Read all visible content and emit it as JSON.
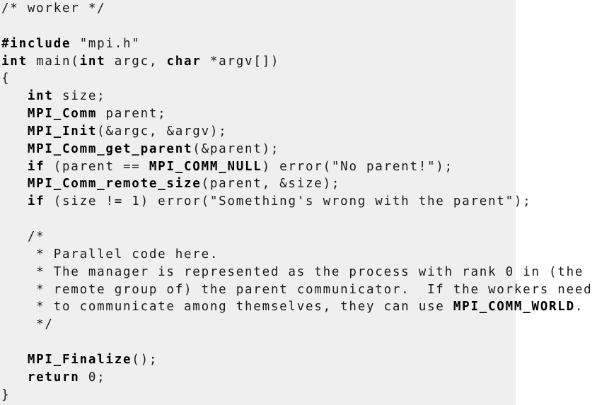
{
  "code_lines": [
    [
      {
        "t": "/* worker */",
        "s": "plain"
      }
    ],
    [],
    [
      {
        "t": "#include",
        "s": "kw"
      },
      {
        "t": " \"mpi.h\"",
        "s": "plain"
      }
    ],
    [
      {
        "t": "int",
        "s": "kw"
      },
      {
        "t": " main(",
        "s": "plain"
      },
      {
        "t": "int",
        "s": "kw"
      },
      {
        "t": " argc, ",
        "s": "plain"
      },
      {
        "t": "char",
        "s": "kw"
      },
      {
        "t": " *argv[])",
        "s": "plain"
      }
    ],
    [
      {
        "t": "{",
        "s": "plain"
      }
    ],
    [
      {
        "t": "   ",
        "s": "plain"
      },
      {
        "t": "int",
        "s": "kw"
      },
      {
        "t": " size;",
        "s": "plain"
      }
    ],
    [
      {
        "t": "   ",
        "s": "plain"
      },
      {
        "t": "MPI_Comm",
        "s": "fn"
      },
      {
        "t": " parent;",
        "s": "plain"
      }
    ],
    [
      {
        "t": "   ",
        "s": "plain"
      },
      {
        "t": "MPI_Init",
        "s": "fn"
      },
      {
        "t": "(&argc, &argv);",
        "s": "plain"
      }
    ],
    [
      {
        "t": "   ",
        "s": "plain"
      },
      {
        "t": "MPI_Comm_get_parent",
        "s": "fn"
      },
      {
        "t": "(&parent);",
        "s": "plain"
      }
    ],
    [
      {
        "t": "   ",
        "s": "plain"
      },
      {
        "t": "if",
        "s": "kw"
      },
      {
        "t": " (parent == ",
        "s": "plain"
      },
      {
        "t": "MPI_COMM_NULL",
        "s": "fn"
      },
      {
        "t": ") error(\"No parent!\");",
        "s": "plain"
      }
    ],
    [
      {
        "t": "   ",
        "s": "plain"
      },
      {
        "t": "MPI_Comm_remote_size",
        "s": "fn"
      },
      {
        "t": "(parent, &size);",
        "s": "plain"
      }
    ],
    [
      {
        "t": "   ",
        "s": "plain"
      },
      {
        "t": "if",
        "s": "kw"
      },
      {
        "t": " (size != 1) error(\"Something's wrong with the parent\");",
        "s": "plain"
      }
    ],
    [],
    [
      {
        "t": "   /*",
        "s": "plain"
      }
    ],
    [
      {
        "t": "    * Parallel code here.",
        "s": "plain"
      }
    ],
    [
      {
        "t": "    * The manager is represented as the process with rank 0 in (the",
        "s": "plain"
      }
    ],
    [
      {
        "t": "    * remote group of) the parent communicator.  If the workers need",
        "s": "plain"
      }
    ],
    [
      {
        "t": "    * to communicate among themselves, they can use ",
        "s": "plain"
      },
      {
        "t": "MPI_COMM_WORLD",
        "s": "fn"
      },
      {
        "t": ".",
        "s": "plain"
      }
    ],
    [
      {
        "t": "    */",
        "s": "plain"
      }
    ],
    [],
    [
      {
        "t": "   ",
        "s": "plain"
      },
      {
        "t": "MPI_Finalize",
        "s": "fn"
      },
      {
        "t": "();",
        "s": "plain"
      }
    ],
    [
      {
        "t": "   ",
        "s": "plain"
      },
      {
        "t": "return",
        "s": "kw"
      },
      {
        "t": " 0;",
        "s": "plain"
      }
    ],
    [
      {
        "t": "}",
        "s": "plain"
      }
    ]
  ],
  "colors": {
    "panel_background": "#efefef",
    "text": "#1a1a1a",
    "keyword": "#000000"
  }
}
